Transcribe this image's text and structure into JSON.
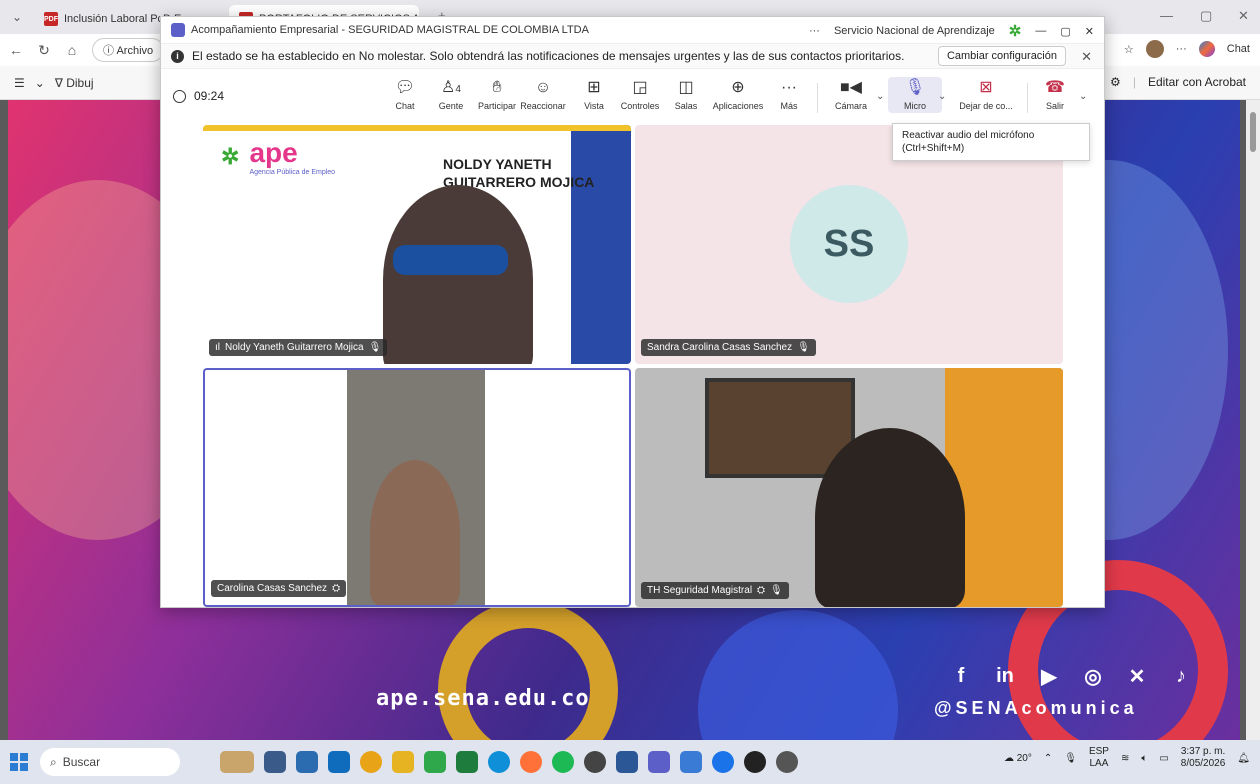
{
  "browser": {
    "tabs": [
      {
        "title": "Inclusión Laboral PcD Empresas"
      },
      {
        "title": "PORTAFOLIO DE SERVICIOS APE"
      }
    ],
    "address_label": "Archivo",
    "chat_label": "Chat",
    "pdf_tool_draw": "Dibuj",
    "acrobat_label": "Editar con Acrobat"
  },
  "pdf_page": {
    "site_url": "ape.sena.edu.co",
    "handle": "@SENAcomunica"
  },
  "teams": {
    "title": "Acompañamiento Empresarial - SEGURIDAD MAGISTRAL DE COLOMBIA LTDA",
    "org_label": "Servicio Nacional de Aprendizaje",
    "notice": "El estado se ha establecido en No molestar. Solo obtendrá las notificaciones de mensajes urgentes y las de sus contactos prioritarios.",
    "notice_button": "Cambiar configuración",
    "timer": "09:24",
    "toolbar": {
      "chat": "Chat",
      "people": "Gente",
      "people_count": "4",
      "raise": "Participar",
      "react": "Reaccionar",
      "view": "Vista",
      "controls": "Controles",
      "rooms": "Salas",
      "apps": "Aplicaciones",
      "more": "Más",
      "camera": "Cámara",
      "mic": "Micro",
      "share": "Dejar de co...",
      "leave": "Salir"
    },
    "tooltip_line1": "Reactivar audio del micrófono",
    "tooltip_line2": "(Ctrl+Shift+M)",
    "tiles": [
      {
        "name": "Noldy Yaneth Guitarrero Mojica",
        "banner": "NOLDY YANETH GUITARRERO MOJICA",
        "logo_text": "ape",
        "logo_sub": "Agencia Pública de Empleo"
      },
      {
        "name": "Sandra Carolina Casas Sanchez",
        "initials": "SS"
      },
      {
        "name": "Carolina Casas Sanchez"
      },
      {
        "name": "TH Seguridad Magistral"
      }
    ]
  },
  "taskbar": {
    "search_placeholder": "Buscar",
    "weather": "20°",
    "lang1": "ESP",
    "lang2": "LAA",
    "time": "3:37 p. m.",
    "date": "8/05/2026"
  }
}
